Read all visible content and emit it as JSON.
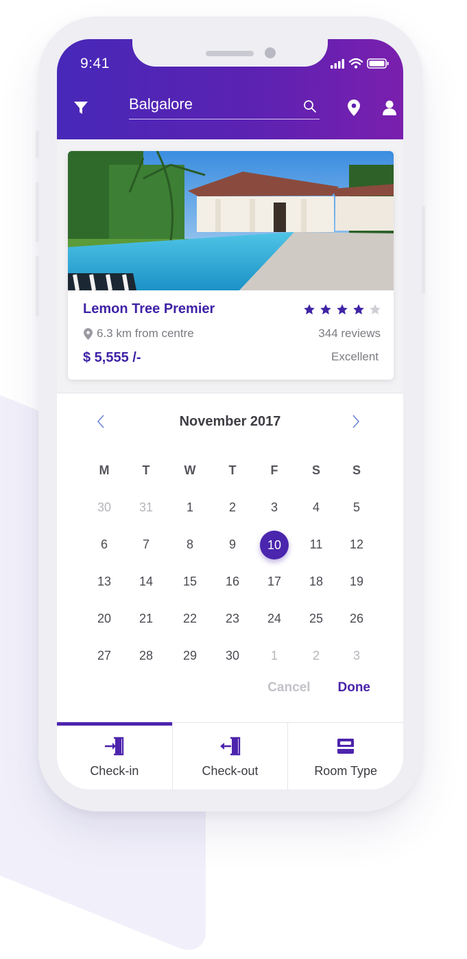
{
  "status_bar": {
    "time": "9:41"
  },
  "header": {
    "search": {
      "value": "Balgalore"
    },
    "icons": [
      "filter-icon",
      "search-icon",
      "location-pin-icon",
      "user-icon"
    ]
  },
  "hotel": {
    "name": "Lemon Tree Premier",
    "rating_stars": 4,
    "max_stars": 5,
    "distance": "6.3 km from centre",
    "reviews": "344 reviews",
    "price": "$ 5,555 /-",
    "rating_label": "Excellent"
  },
  "calendar": {
    "month_label": "November 2017",
    "weekdays": [
      "M",
      "T",
      "W",
      "T",
      "F",
      "S",
      "S"
    ],
    "weeks": [
      [
        "30",
        "31",
        "1",
        "2",
        "3",
        "4",
        "5"
      ],
      [
        "6",
        "7",
        "8",
        "9",
        "10",
        "11",
        "12"
      ],
      [
        "13",
        "14",
        "15",
        "16",
        "17",
        "18",
        "19"
      ],
      [
        "20",
        "21",
        "22",
        "23",
        "24",
        "25",
        "26"
      ],
      [
        "27",
        "28",
        "29",
        "30",
        "1",
        "2",
        "3"
      ]
    ],
    "selected_day": "10",
    "cancel_label": "Cancel",
    "done_label": "Done"
  },
  "tabs": [
    {
      "label": "Check-in",
      "icon": "check-in-icon",
      "active": true
    },
    {
      "label": "Check-out",
      "icon": "check-out-icon",
      "active": false
    },
    {
      "label": "Room Type",
      "icon": "bed-icon",
      "active": false
    }
  ],
  "colors": {
    "accent": "#4a25ad",
    "header_gradient_start": "#4728b8",
    "header_gradient_end": "#7a1fae",
    "star": "#3f23a6",
    "star_empty": "#cfcfd6"
  }
}
